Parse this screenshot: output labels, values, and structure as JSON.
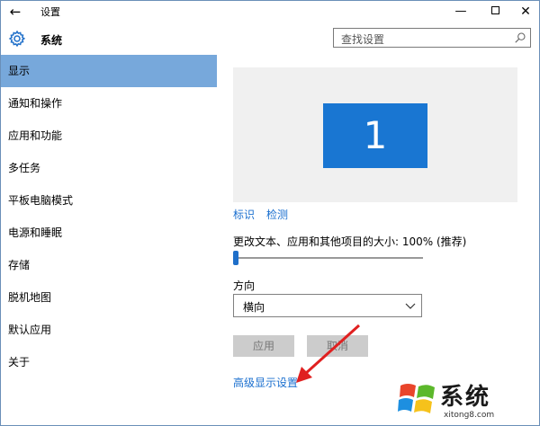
{
  "titlebar": {
    "back_icon": "back-arrow-icon",
    "title": "设置",
    "minimize": "—",
    "close": "✕"
  },
  "header": {
    "icon": "gear-icon",
    "title": "系统",
    "search_placeholder": "查找设置"
  },
  "sidebar": {
    "items": [
      {
        "label": "显示",
        "active": true
      },
      {
        "label": "通知和操作"
      },
      {
        "label": "应用和功能"
      },
      {
        "label": "多任务"
      },
      {
        "label": "平板电脑模式"
      },
      {
        "label": "电源和睡眠"
      },
      {
        "label": "存储"
      },
      {
        "label": "脱机地图"
      },
      {
        "label": "默认应用"
      },
      {
        "label": "关于"
      }
    ]
  },
  "display": {
    "monitor_number": "1",
    "identify_link": "标识",
    "detect_link": "检测",
    "scale_label": "更改文本、应用和其他项目的大小: 100% (推荐)",
    "scale_value_percent": 0,
    "orientation_label": "方向",
    "orientation_value": "横向",
    "apply_button": "应用",
    "cancel_button": "取消",
    "advanced_link": "高级显示设置"
  },
  "watermark": {
    "text": "系统",
    "url": "xitong8.com"
  },
  "colors": {
    "accent": "#1976d2",
    "active_nav": "#77a8db",
    "link": "#1a6fcf",
    "arrow": "#e02020"
  }
}
